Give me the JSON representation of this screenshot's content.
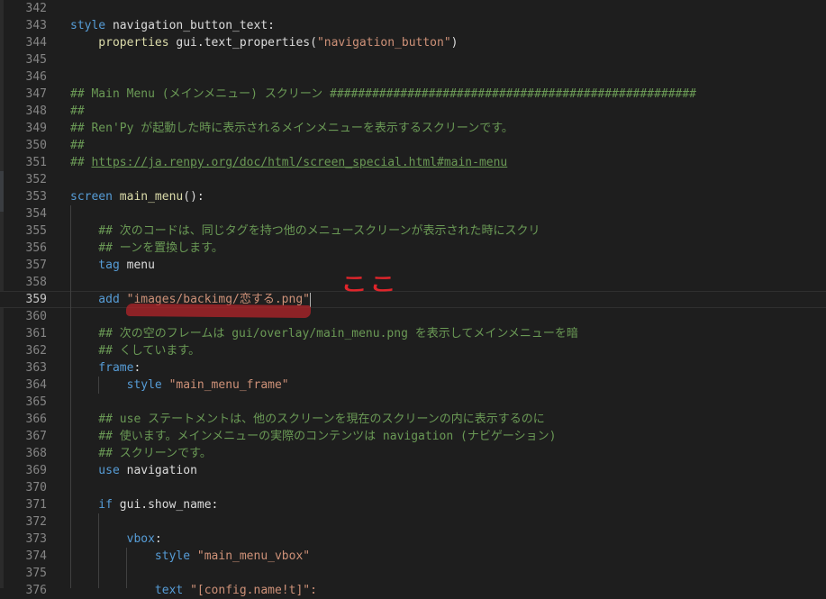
{
  "editor": {
    "lines": [
      {
        "n": "342",
        "tokens": []
      },
      {
        "n": "343",
        "tokens": [
          {
            "t": "style ",
            "c": "kw"
          },
          {
            "t": "navigation_button_text",
            "c": "id"
          },
          {
            "t": ":",
            "c": "id"
          }
        ]
      },
      {
        "n": "344",
        "tokens": [
          {
            "t": "    properties ",
            "c": "fn"
          },
          {
            "t": "gui.text_properties(",
            "c": "id"
          },
          {
            "t": "\"navigation_button\"",
            "c": "str"
          },
          {
            "t": ")",
            "c": "id"
          }
        ]
      },
      {
        "n": "345",
        "tokens": []
      },
      {
        "n": "346",
        "tokens": []
      },
      {
        "n": "347",
        "tokens": [
          {
            "t": "## Main Menu (メインメニュー) スクリーン ####################################################",
            "c": "cm"
          }
        ]
      },
      {
        "n": "348",
        "tokens": [
          {
            "t": "##",
            "c": "cm"
          }
        ]
      },
      {
        "n": "349",
        "tokens": [
          {
            "t": "## Ren'Py が起動した時に表示されるメインメニューを表示するスクリーンです。",
            "c": "cm"
          }
        ]
      },
      {
        "n": "350",
        "tokens": [
          {
            "t": "##",
            "c": "cm"
          }
        ]
      },
      {
        "n": "351",
        "tokens": [
          {
            "t": "## ",
            "c": "cm"
          },
          {
            "t": "https://ja.renpy.org/doc/html/screen_special.html#main-menu",
            "c": "cm",
            "u": true
          }
        ]
      },
      {
        "n": "352",
        "tokens": []
      },
      {
        "n": "353",
        "tokens": [
          {
            "t": "screen ",
            "c": "kw"
          },
          {
            "t": "main_menu",
            "c": "fn"
          },
          {
            "t": "():",
            "c": "id"
          }
        ]
      },
      {
        "n": "354",
        "tokens": []
      },
      {
        "n": "355",
        "tokens": [
          {
            "t": "    ## 次のコードは、同じタグを持つ他のメニュースクリーンが表示された時にスクリ",
            "c": "cm"
          }
        ]
      },
      {
        "n": "356",
        "tokens": [
          {
            "t": "    ## ーンを置換します。",
            "c": "cm"
          }
        ]
      },
      {
        "n": "357",
        "tokens": [
          {
            "t": "    tag ",
            "c": "kw"
          },
          {
            "t": "menu",
            "c": "id"
          }
        ]
      },
      {
        "n": "358",
        "tokens": []
      },
      {
        "n": "359",
        "active": true,
        "tokens": [
          {
            "t": "    add ",
            "c": "kw"
          },
          {
            "t": "\"images/backimg/恋する.png\"",
            "c": "str"
          }
        ],
        "cursor": true
      },
      {
        "n": "360",
        "tokens": []
      },
      {
        "n": "361",
        "tokens": [
          {
            "t": "    ## 次の空のフレームは gui/overlay/main_menu.png を表示してメインメニューを暗",
            "c": "cm"
          }
        ]
      },
      {
        "n": "362",
        "tokens": [
          {
            "t": "    ## くしています。",
            "c": "cm"
          }
        ]
      },
      {
        "n": "363",
        "tokens": [
          {
            "t": "    frame",
            "c": "kw"
          },
          {
            "t": ":",
            "c": "id"
          }
        ]
      },
      {
        "n": "364",
        "tokens": [
          {
            "t": "        style ",
            "c": "kw"
          },
          {
            "t": "\"main_menu_frame\"",
            "c": "str"
          }
        ]
      },
      {
        "n": "365",
        "tokens": []
      },
      {
        "n": "366",
        "tokens": [
          {
            "t": "    ## use ステートメントは、他のスクリーンを現在のスクリーンの内に表示するのに",
            "c": "cm"
          }
        ]
      },
      {
        "n": "367",
        "tokens": [
          {
            "t": "    ## 使います。メインメニューの実際のコンテンツは navigation (ナビゲーション)",
            "c": "cm"
          }
        ]
      },
      {
        "n": "368",
        "tokens": [
          {
            "t": "    ## スクリーンです。",
            "c": "cm"
          }
        ]
      },
      {
        "n": "369",
        "tokens": [
          {
            "t": "    use ",
            "c": "kw"
          },
          {
            "t": "navigation",
            "c": "id"
          }
        ]
      },
      {
        "n": "370",
        "tokens": []
      },
      {
        "n": "371",
        "tokens": [
          {
            "t": "    if ",
            "c": "kw"
          },
          {
            "t": "gui.show_name:",
            "c": "id"
          }
        ]
      },
      {
        "n": "372",
        "tokens": []
      },
      {
        "n": "373",
        "tokens": [
          {
            "t": "        vbox",
            "c": "kw"
          },
          {
            "t": ":",
            "c": "id"
          }
        ]
      },
      {
        "n": "374",
        "tokens": [
          {
            "t": "            style ",
            "c": "kw"
          },
          {
            "t": "\"main_menu_vbox\"",
            "c": "str"
          }
        ]
      },
      {
        "n": "375",
        "tokens": []
      },
      {
        "n": "376",
        "tokens": [
          {
            "t": "            text ",
            "c": "kw"
          },
          {
            "t": "\"[config.name!t]\":",
            "c": "str"
          }
        ]
      }
    ]
  },
  "annotation": {
    "text": "ここ",
    "color": "#e0252b"
  },
  "colors": {
    "background": "#1e1e1e",
    "keyword": "#569cd6",
    "function": "#dcdcaa",
    "string": "#ce9178",
    "comment": "#6a9955",
    "line_number": "#858585"
  }
}
